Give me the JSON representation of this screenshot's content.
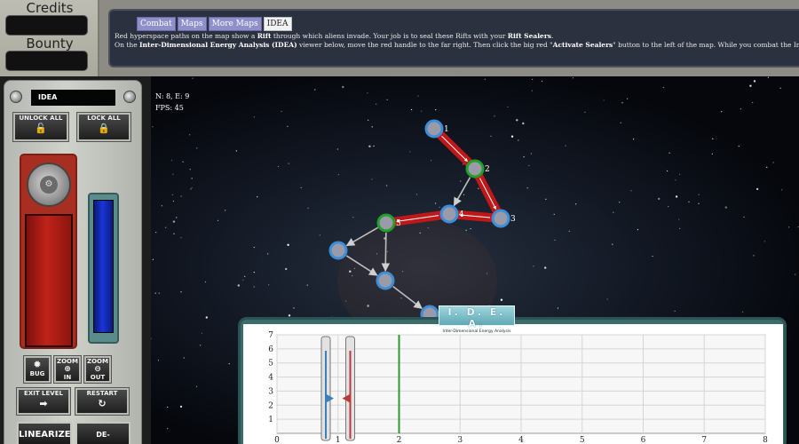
{
  "stats": {
    "credits_label": "Credits",
    "credits_value": "",
    "bounty_label": "Bounty",
    "bounty_value": ""
  },
  "tabs": [
    {
      "label": "Combat",
      "active": false
    },
    {
      "label": "Maps",
      "active": false
    },
    {
      "label": "More Maps",
      "active": false
    },
    {
      "label": "IDEA",
      "active": true
    }
  ],
  "info": {
    "line1_a": "Red hyperspace paths on the map show a ",
    "line1_b": "Rift",
    "line1_c": " through which aliens invade. Your job is to seal these Rifts with your ",
    "line1_d": "Rift Sealers",
    "line1_e": ".",
    "line2_a": "On the ",
    "line2_b": "Inter-Dimensional Energy Analysis (IDEA)",
    "line2_c": " viewer below, move the red handle to the far right. Then click the big red \"",
    "line2_d": "Activate Sealers",
    "line2_e": "\" button to the left of the map. While you combat the Invaders, your Sealers will attempt to seal the R"
  },
  "controls": {
    "panel_label": "IDEA",
    "unlock_all": "UNLOCK ALL",
    "lock_all": "LOCK ALL",
    "bug": "BUG",
    "zoom_in_top": "ZOOM",
    "zoom_in_bottom": "IN",
    "zoom_out_top": "ZOOM",
    "zoom_out_bottom": "OUT",
    "exit_level": "EXIT LEVEL",
    "restart": "RESTART",
    "linearize": "LINEARIZE",
    "de_linearize": "DE-LINEARIZE",
    "red_gauge_level": 1.0,
    "blue_gauge_level": 1.0
  },
  "map": {
    "coords": "N: 8, E: 9",
    "fps": "FPS: 45",
    "nodes": [
      {
        "id": "1",
        "label": "1",
        "status": "normal"
      },
      {
        "id": "2",
        "label": "2",
        "status": "green"
      },
      {
        "id": "3",
        "label": "3",
        "status": "normal"
      },
      {
        "id": "4",
        "label": "4",
        "status": "normal"
      },
      {
        "id": "5",
        "label": "5",
        "status": "green"
      },
      {
        "id": "a",
        "label": "",
        "status": "normal"
      },
      {
        "id": "b",
        "label": "",
        "status": "normal"
      },
      {
        "id": "c",
        "label": "",
        "status": "normal"
      }
    ],
    "rift_path": [
      "1",
      "2",
      "3",
      "4",
      "5"
    ],
    "grey_edges": [
      [
        "2",
        "4"
      ],
      [
        "5",
        "a"
      ],
      [
        "5",
        "b"
      ],
      [
        "a",
        "b"
      ],
      [
        "b",
        "c"
      ]
    ],
    "colors": {
      "rift": "#c01818",
      "node_fill": "#9a9aa8",
      "node_ring": "#3d8ed8",
      "node_green": "#22a02a"
    }
  },
  "idea": {
    "title": "I. D. E. A.",
    "subtitle": "Inter-Dimensional Energy Analysis",
    "x_ticks": [
      "0",
      "1",
      "2",
      "3",
      "4",
      "5",
      "6",
      "7",
      "8"
    ],
    "y_ticks": [
      "1",
      "2",
      "3",
      "4",
      "5",
      "6",
      "7"
    ],
    "xlim": [
      0,
      8
    ],
    "ylim": [
      0,
      7
    ],
    "blue_handle_x": 0.8,
    "red_handle_x": 1.2,
    "green_line_x": 2
  }
}
